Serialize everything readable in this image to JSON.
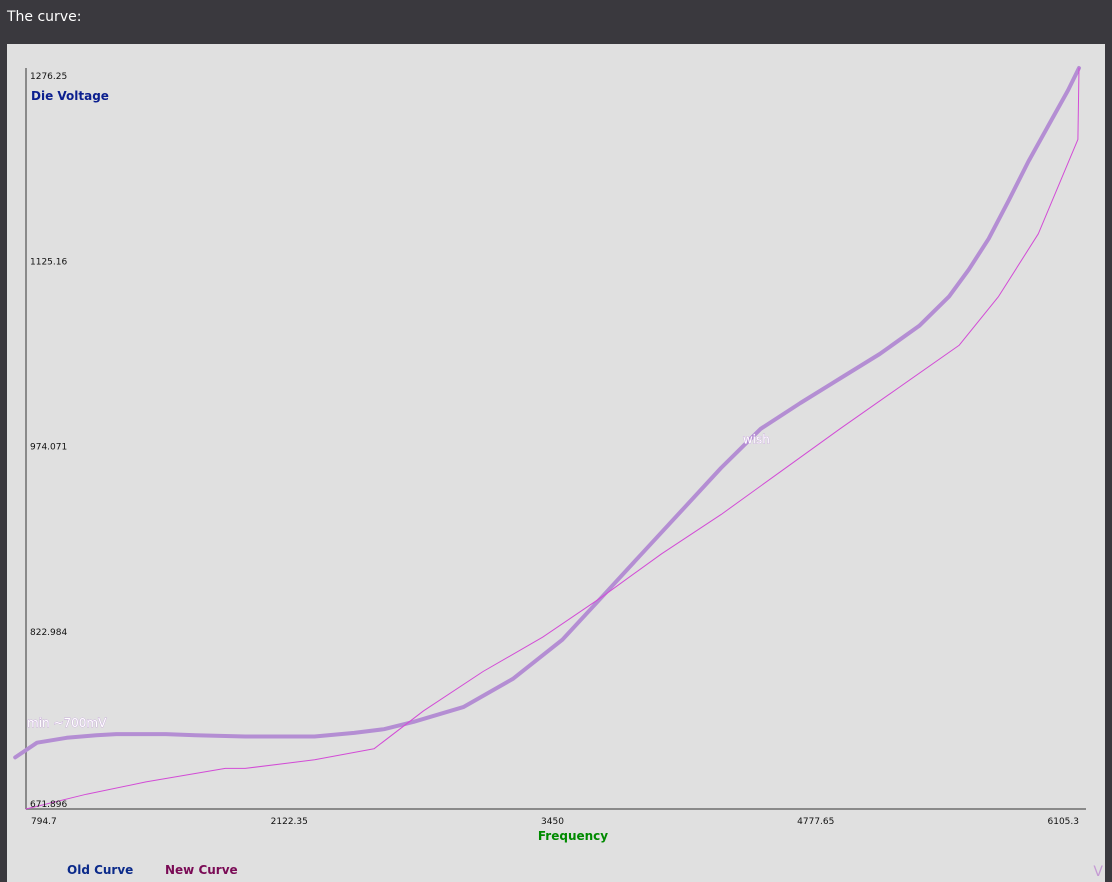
{
  "header": {
    "title": "The curve:"
  },
  "colors": {
    "background": "#e0e0e0",
    "header_bg": "#3a393e",
    "old_curve": "#b48ed3",
    "new_curve": "#d24cd6",
    "ylabel": "#0b1f8f",
    "xlabel": "#008a00",
    "legend_old": "#0b2a8a",
    "legend_new": "#7a0a55"
  },
  "chart_data": {
    "type": "line",
    "xlabel": "Frequency",
    "ylabel": "Die Voltage",
    "xlim": [
      794.7,
      6105.3
    ],
    "ylim": [
      671.896,
      1276.25
    ],
    "x_ticks": [
      "794.7",
      "2122.35",
      "3450",
      "4777.65",
      "6105.3"
    ],
    "y_ticks": [
      "1276.25",
      "1125.16",
      "974.071",
      "822.984",
      "671.896"
    ],
    "annotations": [
      {
        "text": "min ~700mV",
        "x": 794.7,
        "y": 743
      },
      {
        "text": "wish",
        "x": 4410,
        "y": 974
      }
    ],
    "legend": [
      "Old Curve",
      "New Curve"
    ],
    "series": [
      {
        "name": "Old Curve",
        "x": [
          740,
          850,
          1000,
          1150,
          1250,
          1500,
          1650,
          1900,
          2000,
          2250,
          2450,
          2600,
          2750,
          3000,
          3250,
          3500,
          3700,
          3900,
          4100,
          4300,
          4500,
          4700,
          4900,
          5100,
          5300,
          5450,
          5550,
          5650,
          5750,
          5850,
          5950,
          6050,
          6105.3
        ],
        "y": [
          714,
          726,
          730,
          732,
          733,
          733,
          732,
          731,
          731,
          731,
          734,
          737,
          743,
          755,
          778,
          810,
          845,
          880,
          915,
          950,
          982,
          1003,
          1023,
          1043,
          1066,
          1090,
          1112,
          1137,
          1168,
          1200,
          1229,
          1258,
          1276.25
        ]
      },
      {
        "name": "New Curve",
        "x": [
          794.7,
          1100,
          1400,
          1800,
          1900,
          2250,
          2550,
          2800,
          3100,
          3400,
          3700,
          4000,
          4300,
          4600,
          4900,
          5200,
          5500,
          5700,
          5900,
          6100,
          6105.3
        ],
        "y": [
          671.896,
          684,
          694,
          705,
          705,
          712,
          721,
          752,
          784,
          812,
          845,
          880,
          912,
          947,
          982,
          1016,
          1050,
          1090,
          1141,
          1218,
          1276.25
        ]
      }
    ]
  }
}
